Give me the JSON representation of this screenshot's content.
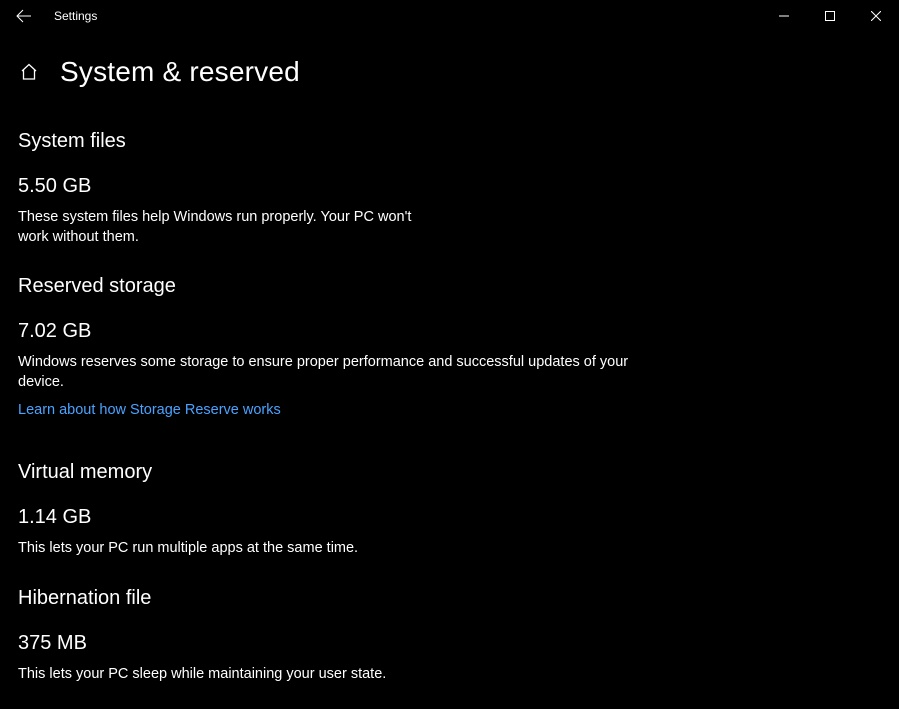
{
  "app_title": "Settings",
  "page_title": "System & reserved",
  "sections": {
    "system_files": {
      "heading": "System files",
      "value": "5.50 GB",
      "desc": "These system files help Windows run properly. Your PC won't work without them."
    },
    "reserved_storage": {
      "heading": "Reserved storage",
      "value": "7.02 GB",
      "desc": "Windows reserves some storage to ensure proper performance and successful updates of your device.",
      "link": "Learn about how Storage Reserve works"
    },
    "virtual_memory": {
      "heading": "Virtual memory",
      "value": "1.14 GB",
      "desc": "This lets your PC run multiple apps at the same time."
    },
    "hibernation_file": {
      "heading": "Hibernation file",
      "value": "375 MB",
      "desc": "This lets your PC sleep while maintaining your user state."
    }
  }
}
